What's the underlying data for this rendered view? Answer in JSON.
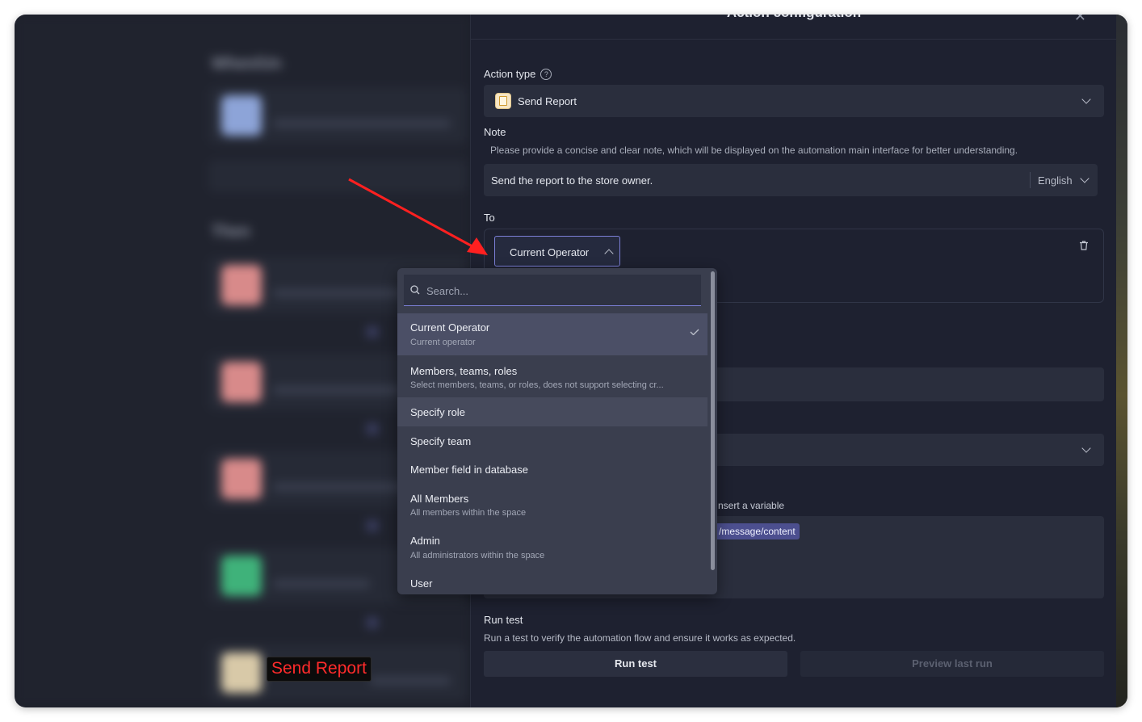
{
  "background": {
    "sections": [
      "When/Un",
      "Then"
    ],
    "overlay_label": "Send Report"
  },
  "panel": {
    "title": "Action configuration",
    "close_icon": "close-icon",
    "action_type": {
      "label": "Action type",
      "value": "Send Report",
      "icon": "report-icon"
    },
    "note": {
      "label": "Note",
      "description": "Please provide a concise and clear note, which will be displayed on the automation main interface for better understanding.",
      "value": "Send the report to the store owner.",
      "language": "English"
    },
    "to": {
      "label": "To",
      "selected": "Current Operator"
    },
    "message": {
      "hint_fragment": "nsert a variable",
      "variable_chip": "/message/content"
    },
    "run_test": {
      "label": "Run test",
      "description": "Run a test to verify the automation flow and ensure it works as expected.",
      "run_button": "Run test",
      "preview_button": "Preview last run"
    }
  },
  "dropdown": {
    "search_placeholder": "Search...",
    "options": [
      {
        "title": "Current Operator",
        "desc": "Current operator",
        "state": "selected"
      },
      {
        "title": "Members, teams, roles",
        "desc": "Select members, teams, or roles, does not support selecting cr..."
      },
      {
        "title": "Specify role",
        "state": "hover"
      },
      {
        "title": "Specify team"
      },
      {
        "title": "Member field in database"
      },
      {
        "title": "All Members",
        "desc": "All members within the space"
      },
      {
        "title": "Admin",
        "desc": "All administrators within the space"
      },
      {
        "title": "User"
      }
    ]
  },
  "colors": {
    "accent": "#7b7fd6",
    "arrow": "#ff2020",
    "panel_bg": "#1e2130",
    "field_bg": "#2a2e3d"
  }
}
